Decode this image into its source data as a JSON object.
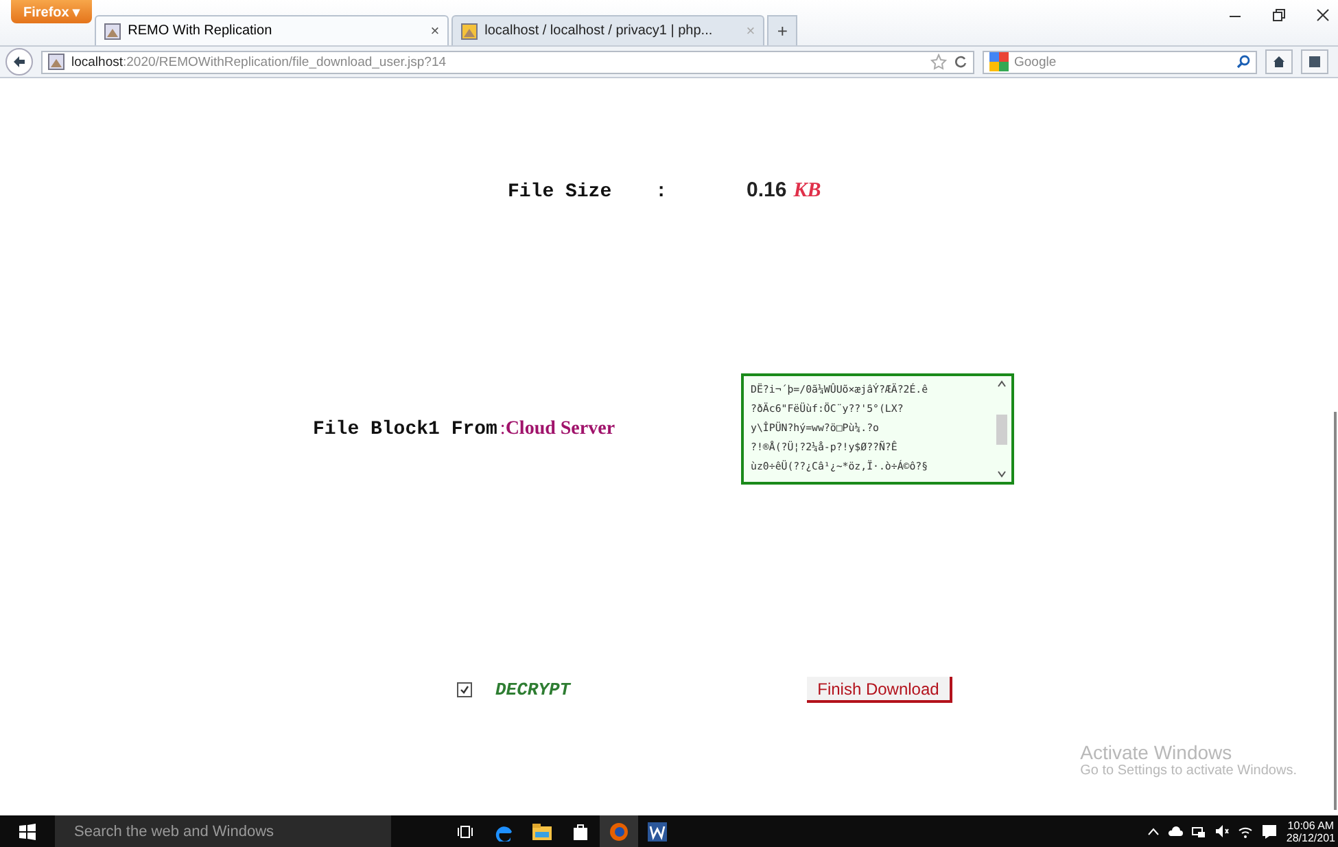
{
  "browser": {
    "menu_button": "Firefox ▾",
    "tabs": [
      {
        "title": "REMO With Replication",
        "selected": true,
        "close": "×"
      },
      {
        "title": "localhost / localhost / privacy1 | php...",
        "selected": false,
        "close": "×"
      }
    ],
    "new_tab": "+",
    "url_host": "localhost",
    "url_rest": ":2020/REMOWithReplication/file_download_user.jsp?14",
    "search_placeholder": "Google"
  },
  "page": {
    "file_size_label": "File Size",
    "file_size_colon": ":",
    "file_size_value": "0.16",
    "file_size_unit": "KB",
    "block_label": "File Block1 From",
    "block_colon": ":",
    "block_source": "Cloud Server",
    "block_content": [
      "DË?i¬´þ=/0ã¼WÛUõ×æjâÝ?ÆÄ?2É.ê",
      "?ðÄc6\"FëÜùf:ÖC¨y??'5°(LX?",
      "y\\ÎPÜN?hý=ww?ö□Pù¼.?o",
      "?!®Å(?Ü¦?2¼å-p?!y$Ø??Ñ?Ê",
      "ùz0÷êÜ(??¿Câ¹¿~*öz,Ï·.ò÷Á©ô?§"
    ],
    "decrypt_checked": true,
    "decrypt_label": "DECRYPT",
    "finish_button": "Finish Download"
  },
  "activation": {
    "title": "Activate Windows",
    "hint": "Go to Settings to activate Windows."
  },
  "taskbar": {
    "search_placeholder": "Search the web and Windows",
    "time": "10:06 AM",
    "date": "28/12/201"
  }
}
